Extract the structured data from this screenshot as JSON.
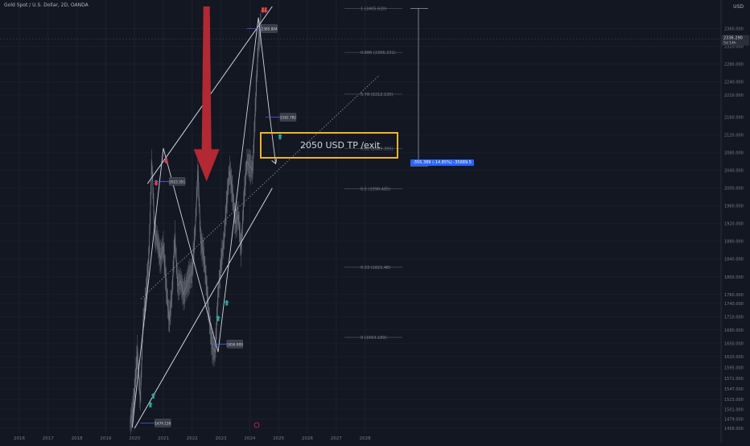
{
  "header": {
    "title": "Gold Spot / U.S. Dollar, 2D, OANDA",
    "currency": "USD"
  },
  "chart_data": {
    "type": "line",
    "title": "Gold Spot / U.S. Dollar, 2D, OANDA",
    "xlabel": "",
    "ylabel": "",
    "x_ticks": [
      "2016",
      "2017",
      "2018",
      "2019",
      "2020",
      "2021",
      "2022",
      "2023",
      "2024",
      "2025",
      "2026",
      "2027",
      "2028"
    ],
    "y_ticks": [
      2360.0,
      2320.0,
      2280.0,
      2240.0,
      2210.0,
      2160.0,
      2120.0,
      2080.0,
      2040.0,
      2000.0,
      1960.0,
      1920.0,
      1880.0,
      1840.0,
      1800.0,
      1760.0,
      1740.0,
      1710.0,
      1680.0,
      1650.0,
      1620.0,
      1595.0,
      1571.0,
      1547.0,
      1523.0,
      1501.0,
      1479.0,
      1458.0
    ],
    "ylim": [
      1458,
      2410
    ],
    "price_series": [
      {
        "x": 2019.85,
        "y": 1470
      },
      {
        "x": 2019.95,
        "y": 1500
      },
      {
        "x": 2020.02,
        "y": 1560
      },
      {
        "x": 2020.1,
        "y": 1630
      },
      {
        "x": 2020.2,
        "y": 1520
      },
      {
        "x": 2020.3,
        "y": 1700
      },
      {
        "x": 2020.4,
        "y": 1760
      },
      {
        "x": 2020.5,
        "y": 1850
      },
      {
        "x": 2020.6,
        "y": 2060
      },
      {
        "x": 2020.7,
        "y": 1900
      },
      {
        "x": 2020.8,
        "y": 1880
      },
      {
        "x": 2020.9,
        "y": 1840
      },
      {
        "x": 2021.0,
        "y": 1870
      },
      {
        "x": 2021.1,
        "y": 1780
      },
      {
        "x": 2021.2,
        "y": 1700
      },
      {
        "x": 2021.3,
        "y": 1760
      },
      {
        "x": 2021.4,
        "y": 1890
      },
      {
        "x": 2021.5,
        "y": 1780
      },
      {
        "x": 2021.6,
        "y": 1790
      },
      {
        "x": 2021.7,
        "y": 1760
      },
      {
        "x": 2021.8,
        "y": 1780
      },
      {
        "x": 2021.9,
        "y": 1800
      },
      {
        "x": 2022.0,
        "y": 1810
      },
      {
        "x": 2022.1,
        "y": 1900
      },
      {
        "x": 2022.2,
        "y": 2040
      },
      {
        "x": 2022.3,
        "y": 1880
      },
      {
        "x": 2022.4,
        "y": 1850
      },
      {
        "x": 2022.5,
        "y": 1780
      },
      {
        "x": 2022.6,
        "y": 1700
      },
      {
        "x": 2022.7,
        "y": 1640
      },
      {
        "x": 2022.8,
        "y": 1630
      },
      {
        "x": 2022.9,
        "y": 1760
      },
      {
        "x": 2023.0,
        "y": 1830
      },
      {
        "x": 2023.1,
        "y": 1880
      },
      {
        "x": 2023.2,
        "y": 1970
      },
      {
        "x": 2023.3,
        "y": 2040
      },
      {
        "x": 2023.4,
        "y": 1990
      },
      {
        "x": 2023.5,
        "y": 1920
      },
      {
        "x": 2023.6,
        "y": 1940
      },
      {
        "x": 2023.7,
        "y": 1860
      },
      {
        "x": 2023.8,
        "y": 1980
      },
      {
        "x": 2023.9,
        "y": 2060
      },
      {
        "x": 2024.0,
        "y": 2050
      },
      {
        "x": 2024.1,
        "y": 2040
      },
      {
        "x": 2024.2,
        "y": 2190
      },
      {
        "x": 2024.3,
        "y": 2330
      },
      {
        "x": 2024.4,
        "y": 2370
      }
    ],
    "channel_upper": [
      {
        "x": 2020.45,
        "y": 2010
      },
      {
        "x": 2024.78,
        "y": 2410
      }
    ],
    "channel_lower": [
      {
        "x": 2020.0,
        "y": 1458
      },
      {
        "x": 2024.78,
        "y": 2000
      }
    ],
    "channel_mid": [
      {
        "x": 2020.22,
        "y": 1750
      },
      {
        "x": 2028.5,
        "y": 2255
      }
    ],
    "zigzag": [
      {
        "x": 2019.92,
        "y": 1460
      },
      {
        "x": 2021.0,
        "y": 2090
      },
      {
        "x": 2022.9,
        "y": 1630
      },
      {
        "x": 2024.3,
        "y": 2385
      },
      {
        "x": 2024.68,
        "y": 2170
      },
      {
        "x": 2024.9,
        "y": 2055
      }
    ],
    "fib_levels": [
      {
        "ratio": "1",
        "label": "1 (2405.620)",
        "price": 2405.62
      },
      {
        "ratio": "0.886",
        "label": "0.886 (2306.231)",
        "price": 2306.231
      },
      {
        "ratio": "0.78",
        "label": "0.78 (2212.135)",
        "price": 2212.135
      },
      {
        "ratio": "0.62",
        "label": "0.62 (2089.395)",
        "price": 2089.395
      },
      {
        "ratio": "0.5",
        "label": "0.5 (1998.485)",
        "price": 1998.485
      },
      {
        "ratio": "0.33",
        "label": "0.33 (1821.48)",
        "price": 1821.48
      },
      {
        "ratio": "0",
        "label": "0 (1663.189)",
        "price": 1663.189
      }
    ],
    "price_callouts": [
      {
        "label": "2385.804",
        "x": 2024.4,
        "y": 2360
      },
      {
        "label": "2162.782",
        "x": 2025.05,
        "y": 2160
      },
      {
        "label": "2023.351",
        "x": 2021.2,
        "y": 2015
      },
      {
        "label": "1656.089",
        "x": 2023.2,
        "y": 1648
      },
      {
        "label": "1474.139",
        "x": 2020.7,
        "y": 1470
      }
    ],
    "down_arrows": [
      {
        "x": 2020.75,
        "y": 2005
      },
      {
        "x": 2021.1,
        "y": 2055
      },
      {
        "x": 2024.45,
        "y": 2395
      },
      {
        "x": 2024.55,
        "y": 2395
      }
    ],
    "up_arrows": [
      {
        "x": 2020.55,
        "y": 1505
      },
      {
        "x": 2020.65,
        "y": 1525
      },
      {
        "x": 2022.9,
        "y": 1700
      },
      {
        "x": 2023.2,
        "y": 1735
      },
      {
        "x": 2025.05,
        "y": 2110
      }
    ],
    "big_arrow": {
      "x": 2022.5,
      "top": 2410,
      "bottom": 2015
    },
    "tp_zone": {
      "label": "2050 USD TP /exit",
      "top": 2082,
      "bottom": 2008
    },
    "measurement": {
      "label": "-355.389 (-14.85%) -35689.5",
      "top": 2405.62,
      "bottom": 2050
    },
    "current_price": {
      "value": "2336.290",
      "sub": "5d 14h"
    }
  }
}
